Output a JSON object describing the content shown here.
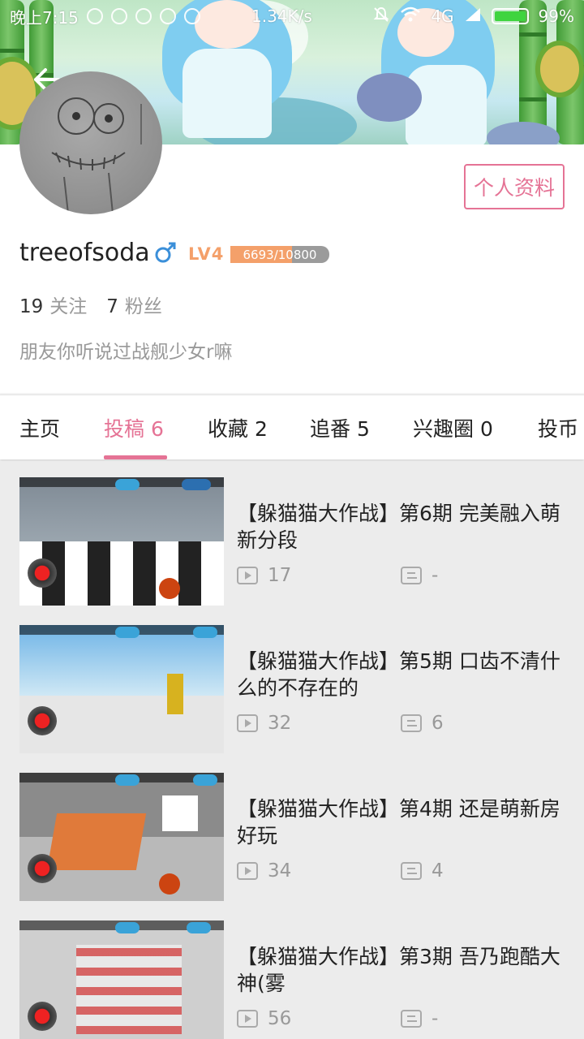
{
  "status_bar": {
    "time": "晚上7:15",
    "net_speed": "1.34K/s",
    "carrier": "4G",
    "battery": "99%"
  },
  "header": {
    "back_icon": "back-arrow-icon"
  },
  "profile": {
    "username": "treeofsoda",
    "gender_icon": "male-icon",
    "level": "LV4",
    "exp_text": "6693/10800",
    "exp_fraction": 0.62,
    "edit_button": "个人资料",
    "follow_count": "19",
    "follow_label": "关注",
    "fans_count": "7",
    "fans_label": "粉丝",
    "bio": "朋友你听说过战舰少女r嘛"
  },
  "tabs": [
    {
      "label": "主页"
    },
    {
      "label": "投稿 6"
    },
    {
      "label": "收藏 2"
    },
    {
      "label": "追番 5"
    },
    {
      "label": "兴趣圈 0"
    },
    {
      "label": "投币"
    }
  ],
  "videos": [
    {
      "title": "【躲猫猫大作战】第6期 完美融入萌新分段",
      "plays": "17",
      "danmaku": "-"
    },
    {
      "title": "【躲猫猫大作战】第5期 口齿不清什么的不存在的",
      "plays": "32",
      "danmaku": "6"
    },
    {
      "title": "【躲猫猫大作战】第4期 还是萌新房好玩",
      "plays": "34",
      "danmaku": "4"
    },
    {
      "title": "【躲猫猫大作战】第3期 吾乃跑酷大神(雾",
      "plays": "56",
      "danmaku": "-"
    }
  ],
  "colors": {
    "accent": "#e57395",
    "level": "#f4a06a"
  }
}
